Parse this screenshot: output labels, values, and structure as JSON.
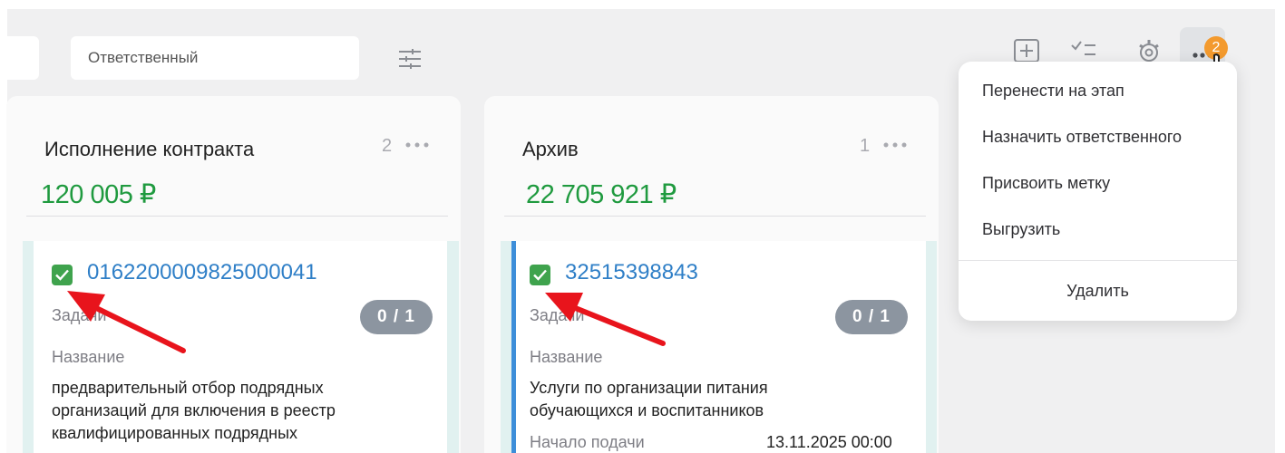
{
  "toolbar": {
    "responsible_placeholder": "Ответственный",
    "more_badge_count": "2"
  },
  "columns": [
    {
      "title": "Исполнение контракта",
      "count": "2",
      "sum": "120 005 ₽",
      "card": {
        "number": "0162200009825000041",
        "tasks_label": "Задачи",
        "tasks_badge": "0 / 1",
        "name_label": "Название",
        "name_lines": [
          "предварительный отбор подрядных",
          "организаций для включения в реестр",
          "квалифицированных подрядных"
        ]
      }
    },
    {
      "title": "Архив",
      "count": "1",
      "sum": "22 705 921 ₽",
      "card": {
        "number": "32515398843",
        "tasks_label": "Задачи",
        "tasks_badge": "0 / 1",
        "name_label": "Название",
        "name_lines": [
          "Услуги по организации питания",
          "обучающихся и воспитанников"
        ],
        "start_label": "Начало подачи",
        "start_value": "13.11.2025 00:00"
      }
    }
  ],
  "menu": {
    "items": [
      "Перенести на этап",
      "Назначить ответственного",
      "Присвоить метку",
      "Выгрузить"
    ],
    "delete_label": "Удалить"
  },
  "colors": {
    "accent_green": "#1f9a3f",
    "link_blue": "#2f7fc7",
    "badge_orange": "#f39a2e",
    "annotation_red": "#e8141c"
  },
  "icons": [
    "sliders-icon",
    "add-box-icon",
    "checklist-icon",
    "gear-icon",
    "more-dots-icon",
    "hand-cursor-icon",
    "checkbox-checked-icon"
  ]
}
